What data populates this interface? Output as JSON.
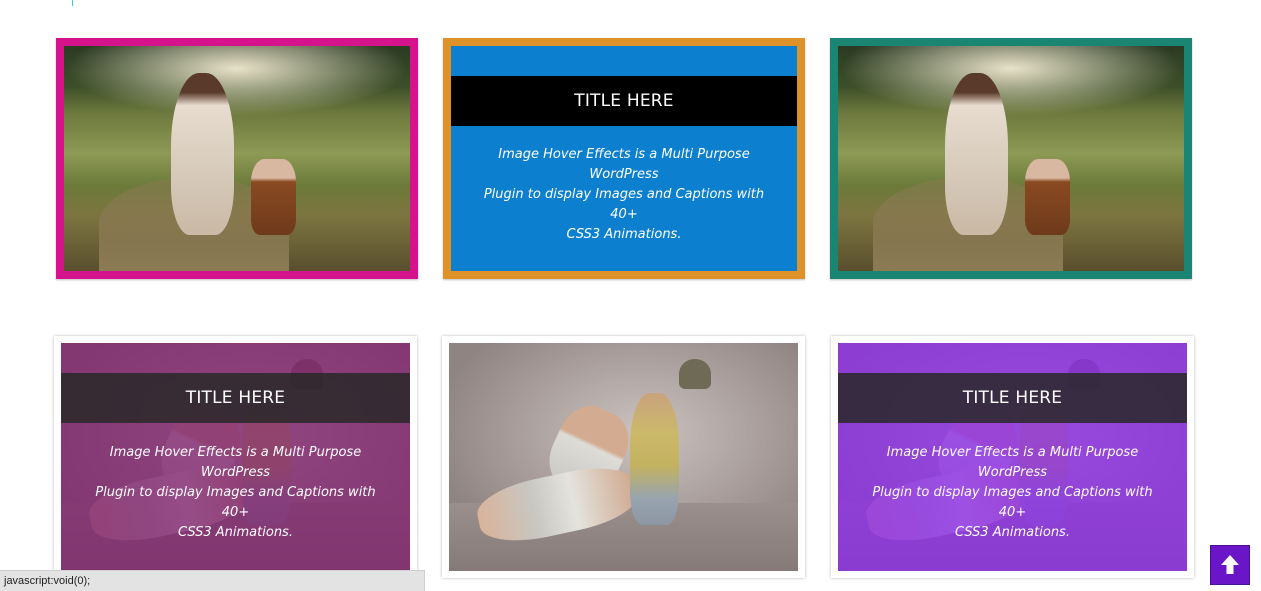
{
  "colors": {
    "card1_border": "#d5138c",
    "card2_border": "#e0922a",
    "card2_fill": "#0c80cf",
    "card3_border": "#1a8572",
    "title_bar_dark": "#000000",
    "card4_overlay": "rgba(128,34,110,0.78)",
    "card6_overlay": "rgba(140,44,230,0.80)",
    "scroll_top": "#6a16c8"
  },
  "cards": [
    {
      "id": "card-1",
      "state": "image",
      "image": "woman-sitting-in-field-photo"
    },
    {
      "id": "card-2",
      "state": "hover",
      "title": "TITLE HERE",
      "description_lines": [
        "Image Hover Effects is a Multi Purpose WordPress",
        "Plugin to display Images and Captions with 40+",
        "CSS3 Animations."
      ]
    },
    {
      "id": "card-3",
      "state": "image",
      "image": "woman-sitting-in-field-photo"
    },
    {
      "id": "card-4",
      "state": "hover",
      "image": "woman-sitting-with-hat-photo",
      "title": "TITLE HERE",
      "description_lines": [
        "Image Hover Effects is a Multi Purpose WordPress",
        "Plugin to display Images and Captions with 40+",
        "CSS3 Animations."
      ]
    },
    {
      "id": "card-5",
      "state": "image",
      "image": "woman-sitting-with-hat-photo"
    },
    {
      "id": "card-6",
      "state": "hover",
      "image": "woman-sitting-with-hat-photo",
      "title": "TITLE HERE",
      "description_lines": [
        "Image Hover Effects is a Multi Purpose WordPress",
        "Plugin to display Images and Captions with 40+",
        "CSS3 Animations."
      ]
    }
  ],
  "status_bar": {
    "text": "javascript:void(0);"
  },
  "scroll_top": {
    "icon": "arrow-up-icon"
  }
}
